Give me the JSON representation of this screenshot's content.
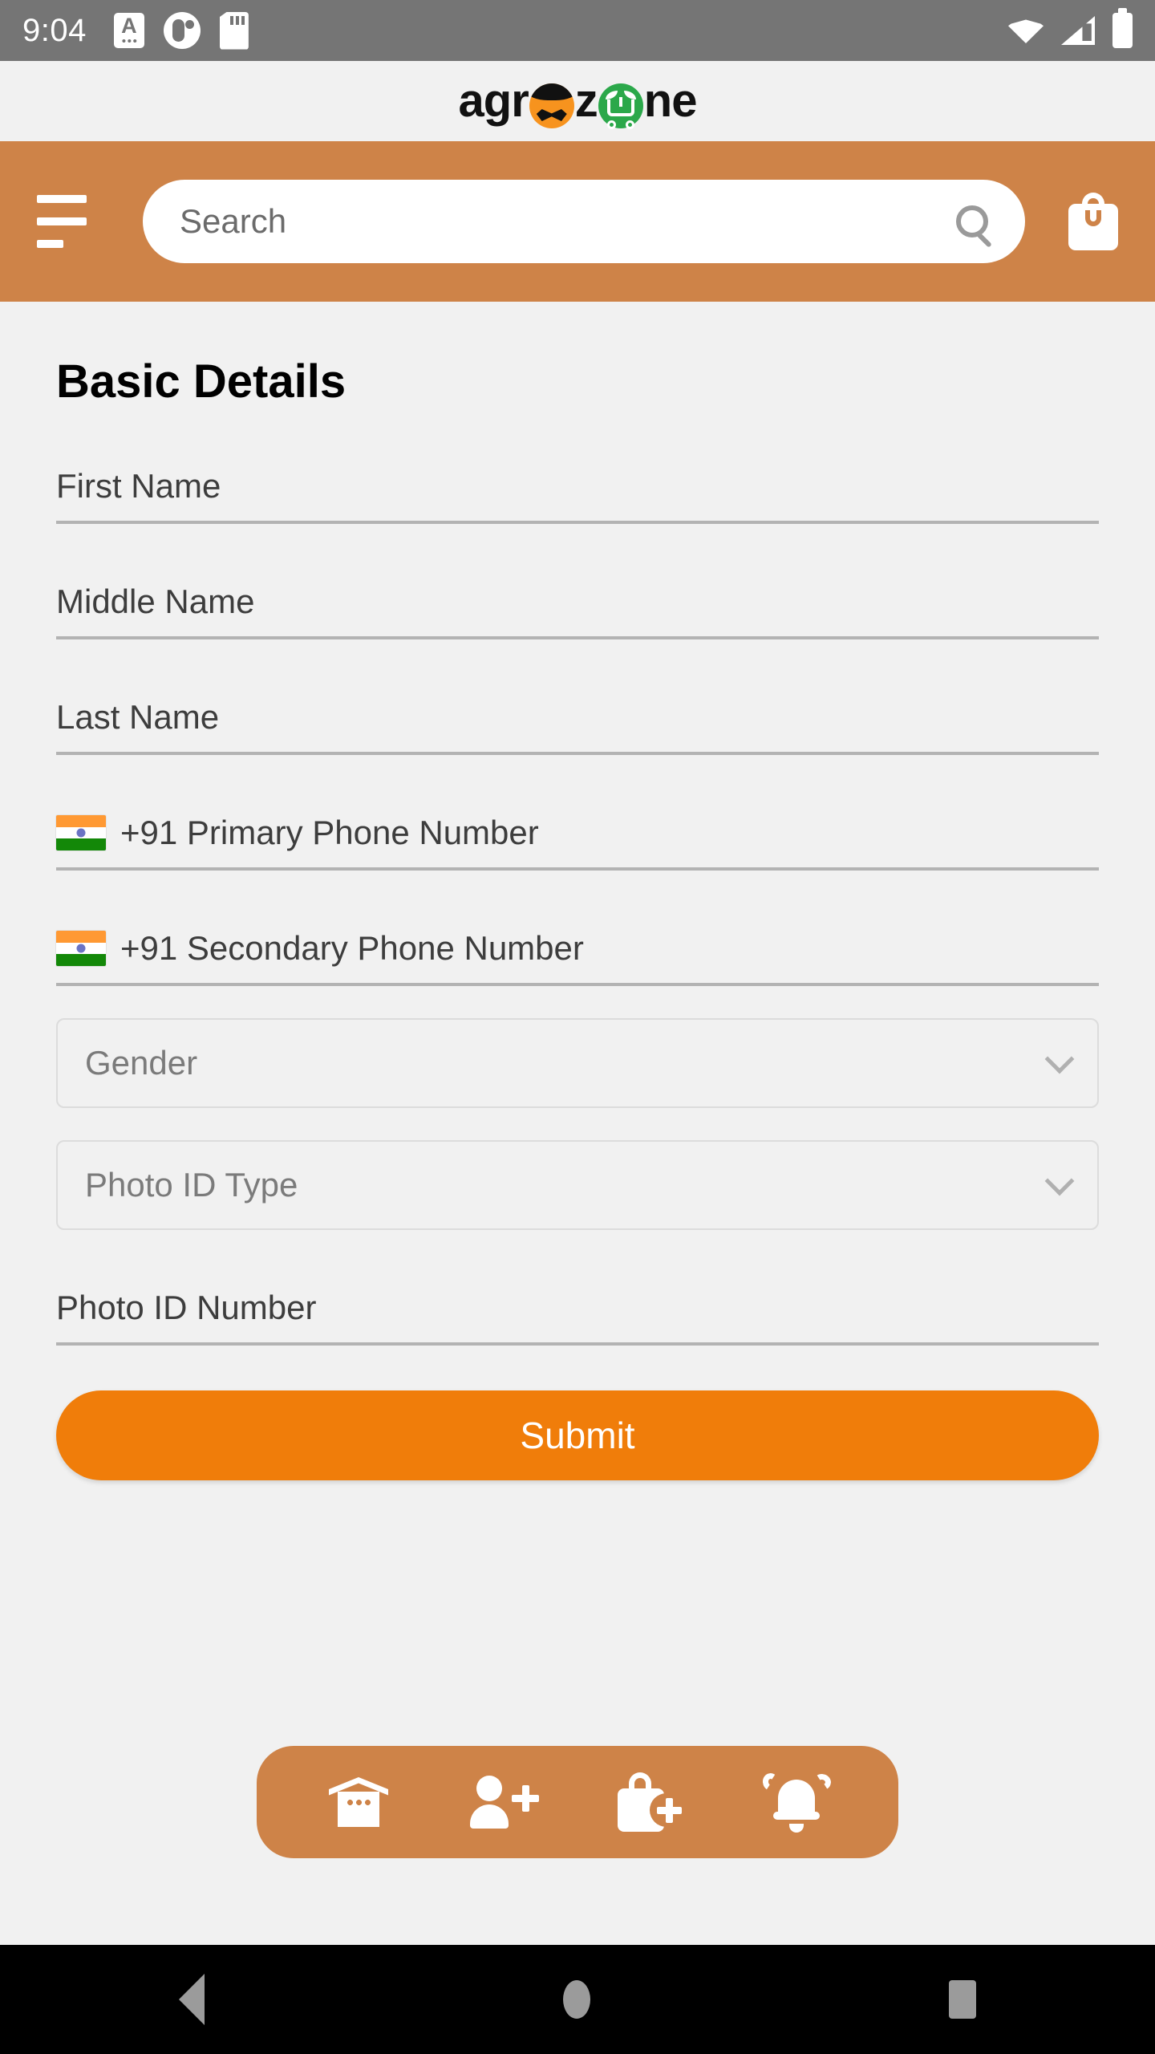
{
  "status_bar": {
    "clock": "9:04",
    "left_icons": [
      "keyboard-icon",
      "circle-app-icon",
      "sd-card-icon"
    ],
    "right_icons": [
      "wifi-icon",
      "cellular-signal-icon",
      "battery-icon"
    ],
    "background": "#757575"
  },
  "brand": {
    "name": "agrozone",
    "part1": "agr",
    "part2": "z",
    "part3": "ne",
    "farmer_color": "#F7931E",
    "cart_color": "#2BA84A"
  },
  "appbar": {
    "background": "#ce8348",
    "menu_icon": "hamburger-menu-icon",
    "cart_icon": "shopping-bag-icon",
    "search": {
      "value": "",
      "placeholder": "Search",
      "icon": "search-icon"
    }
  },
  "main": {
    "title": "Basic Details",
    "fields": [
      {
        "name": "first-name",
        "placeholder": "First Name",
        "value": "",
        "type": "text"
      },
      {
        "name": "middle-name",
        "placeholder": "Middle Name",
        "value": "",
        "type": "text"
      },
      {
        "name": "last-name",
        "placeholder": "Last Name",
        "value": "",
        "type": "text"
      },
      {
        "name": "primary-phone",
        "placeholder": "+91 Primary Phone Number",
        "value": "",
        "type": "phone",
        "flag": "india-flag-icon",
        "dial_code": "+91"
      },
      {
        "name": "secondary-phone",
        "placeholder": "+91 Secondary Phone Number",
        "value": "",
        "type": "phone",
        "flag": "india-flag-icon",
        "dial_code": "+91"
      }
    ],
    "selects": [
      {
        "name": "gender",
        "placeholder": "Gender",
        "value": "",
        "icon": "chevron-down-icon"
      },
      {
        "name": "photo-id-type",
        "placeholder": "Photo ID Type",
        "value": "",
        "icon": "chevron-down-icon"
      }
    ],
    "photo_id_number": {
      "name": "photo-id-number",
      "placeholder": "Photo ID Number",
      "value": ""
    },
    "submit_label": "Submit",
    "submit_color": "#F07D0A"
  },
  "bottom_nav": {
    "background": "#ce8348",
    "items": [
      {
        "name": "home",
        "icon": "home-icon"
      },
      {
        "name": "add-user",
        "icon": "person-add-icon"
      },
      {
        "name": "add-order",
        "icon": "bag-add-icon"
      },
      {
        "name": "notifications",
        "icon": "bell-icon"
      }
    ]
  },
  "android_nav": {
    "background": "#000000",
    "items": [
      {
        "name": "back",
        "icon": "back-triangle-icon"
      },
      {
        "name": "home",
        "icon": "home-circle-icon"
      },
      {
        "name": "recents",
        "icon": "recents-square-icon"
      }
    ]
  }
}
